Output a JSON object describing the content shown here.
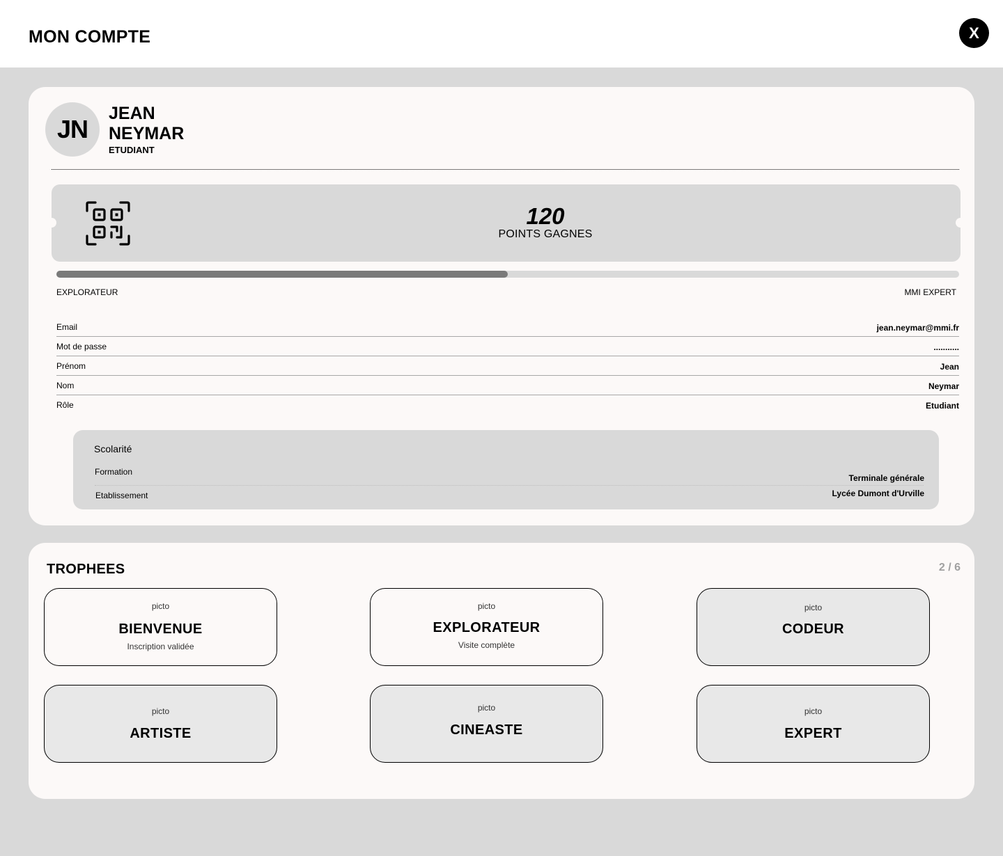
{
  "header": {
    "title": "MON COMPTE",
    "close_label": "X"
  },
  "profile": {
    "initials": "JN",
    "first_name": "JEAN",
    "last_name": "NEYMAR",
    "role": "ETUDIANT"
  },
  "points": {
    "value": "120",
    "label": "POINTS GAGNES",
    "icon": "qr-code-icon"
  },
  "progress": {
    "fraction": 0.5,
    "start_level": "EXPLORATEUR",
    "end_level": "MMI EXPERT"
  },
  "info": [
    {
      "label": "Email",
      "value": "jean.neymar@mmi.fr"
    },
    {
      "label": "Mot de passe",
      "value": "..........."
    },
    {
      "label": "Prénom",
      "value": "Jean"
    },
    {
      "label": "Nom",
      "value": "Neymar"
    },
    {
      "label": "Rôle",
      "value": "Etudiant"
    }
  ],
  "scolarite": {
    "title": "Scolarité",
    "formation_label": "Formation",
    "formation_value": "Terminale générale",
    "etablissement_label": "Etablissement",
    "etablissement_value": "Lycée Dumont d'Urville"
  },
  "trophies": {
    "title": "TROPHEES",
    "count": "2 / 6",
    "items": [
      {
        "picto": "picto",
        "name": "BIENVENUE",
        "desc": "Inscription validée",
        "unlocked": true
      },
      {
        "picto": "picto",
        "name": "EXPLORATEUR",
        "desc": "Visite complète",
        "unlocked": true
      },
      {
        "picto": "picto",
        "name": "CODEUR",
        "desc": "",
        "unlocked": false
      },
      {
        "picto": "picto",
        "name": "ARTISTE",
        "desc": "",
        "unlocked": false
      },
      {
        "picto": "picto",
        "name": "CINEASTE",
        "desc": "",
        "unlocked": false
      },
      {
        "picto": "picto",
        "name": "EXPERT",
        "desc": "",
        "unlocked": false
      }
    ]
  },
  "colors": {
    "background": "#d9d9d9",
    "card": "#fcf9f8",
    "progress_fill": "#7a7a7a",
    "locked_trophy": "#e8e8e8"
  }
}
